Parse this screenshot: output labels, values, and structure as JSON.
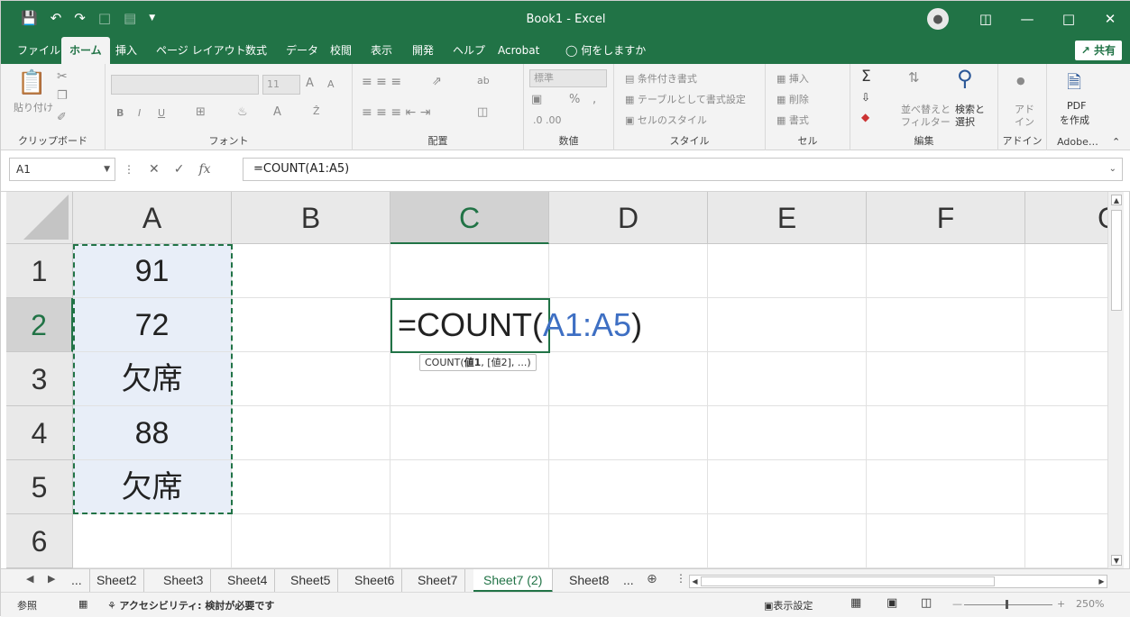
{
  "title_bar": {
    "title": "Book1  -  Excel",
    "qat": [
      "save-icon",
      "undo-icon",
      "redo-icon",
      "new-icon",
      "form-icon",
      "customize-icon"
    ]
  },
  "tabs": [
    "ファイル",
    "ホーム",
    "挿入",
    "ページ レイアウト",
    "数式",
    "データ",
    "校閲",
    "表示",
    "開発",
    "ヘルプ",
    "Acrobat",
    "何をしますか"
  ],
  "share_label": "共有",
  "ribbon": {
    "clipboard": {
      "label": "クリップボード",
      "paste": "貼り付け"
    },
    "font": {
      "label": "フォント",
      "size": "11"
    },
    "alignment": {
      "label": "配置"
    },
    "number": {
      "label": "数値",
      "format": "標準"
    },
    "styles": {
      "label": "スタイル",
      "conditional": "条件付き書式",
      "table": "テーブルとして書式設定",
      "cell_style": "セルのスタイル"
    },
    "cells": {
      "label": "セル",
      "insert": "挿入",
      "delete": "削除",
      "format": "書式"
    },
    "editing": {
      "label": "編集",
      "sort": "並べ替えと",
      "filter": "フィルター",
      "find": "検索と",
      "select": "選択"
    },
    "addins": {
      "label": "アドイン",
      "top": "アド",
      "bottom": "イン"
    },
    "adobe": {
      "label": "Adobe…",
      "pdf": "PDF",
      "create": "を作成"
    }
  },
  "formula_bar": {
    "name_box": "A1",
    "formula": "=COUNT(A1:A5)",
    "fx": "fx"
  },
  "columns": [
    "A",
    "B",
    "C",
    "D",
    "E",
    "F",
    "G"
  ],
  "rows": [
    "1",
    "2",
    "3",
    "4",
    "5",
    "6"
  ],
  "cells": {
    "A1": "91",
    "A2": "72",
    "A3": "欠席",
    "A4": "88",
    "A5": "欠席"
  },
  "editor": {
    "prefix": "=COUNT(",
    "ref": "A1:A5",
    "suffix": ")"
  },
  "tooltip": {
    "fn": "COUNT(",
    "arg1": "値1",
    "rest": ", [値2], ...)"
  },
  "sheets": [
    "...",
    "Sheet2",
    "Sheet3",
    "Sheet4",
    "Sheet5",
    "Sheet6",
    "Sheet7",
    "Sheet7 (2)",
    "Sheet8",
    "..."
  ],
  "active_sheet": "Sheet7 (2)",
  "status": {
    "mode": "参照",
    "accessibility": "アクセシビリティ: 検討が必要です",
    "display_settings": "表示設定",
    "zoom": "250%"
  },
  "colors": {
    "accent": "#217346",
    "ref": "#3e6fc3",
    "selection": "#e8eef8"
  }
}
